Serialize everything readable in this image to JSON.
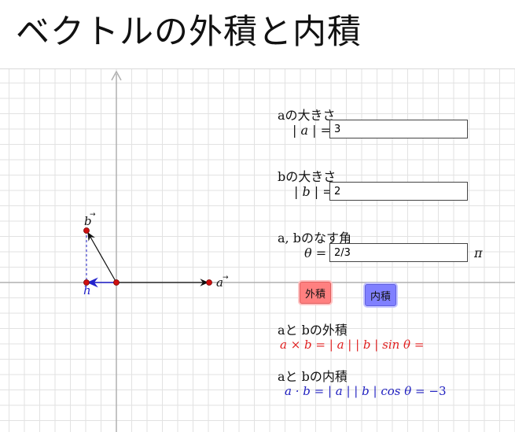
{
  "title": "ベクトルの外積と内積",
  "vec_a": {
    "label": "aの大きさ",
    "eq": "| a | =",
    "value": "3"
  },
  "vec_b": {
    "label": "bの大きさ",
    "eq": "| b | =",
    "value": "2"
  },
  "angle": {
    "label": "a, bのなす角",
    "eq": "θ =",
    "value": "2/3",
    "unit": "π"
  },
  "buttons": {
    "cross": "外積",
    "dot": "内積"
  },
  "cross_result": {
    "label": "aと bの外積",
    "formula": "a × b = | a | | b | sin θ ="
  },
  "dot_result": {
    "label": "aと bの内積",
    "formula": "a · b = | a | | b | cos θ =",
    "value": "−3"
  },
  "graph": {
    "point_labels": {
      "a": "a",
      "b": "b",
      "h": "h"
    }
  },
  "colors": {
    "cross": "#e02020",
    "dot": "#2020c0",
    "point": "#d01010",
    "projection": "#2222cc"
  }
}
